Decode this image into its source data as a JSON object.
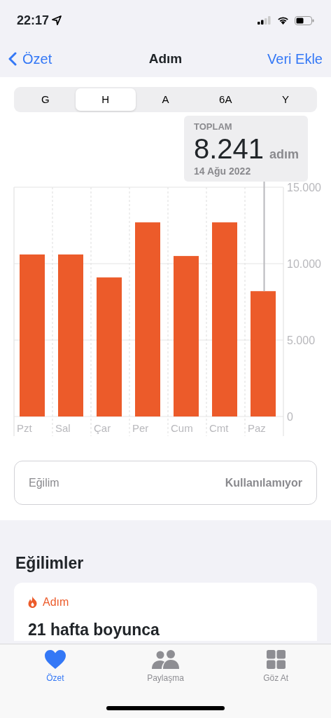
{
  "status_bar": {
    "time": "22:17"
  },
  "nav": {
    "back": "Özet",
    "title": "Adım",
    "action": "Veri Ekle"
  },
  "segments": [
    {
      "label": "G",
      "selected": false
    },
    {
      "label": "H",
      "selected": true
    },
    {
      "label": "A",
      "selected": false
    },
    {
      "label": "6A",
      "selected": false
    },
    {
      "label": "Y",
      "selected": false
    }
  ],
  "summary": {
    "label": "TOPLAM",
    "value": "8.241",
    "unit": "adım",
    "date": "14 Ağu 2022"
  },
  "chart": {
    "chart_data": {
      "type": "bar",
      "categories": [
        "Pzt",
        "Sal",
        "Çar",
        "Per",
        "Cum",
        "Cmt",
        "Paz"
      ],
      "series": [
        {
          "color": "#ec5b2a",
          "values": [
            10600,
            10600,
            9100,
            12700,
            10500,
            12700,
            8200
          ]
        }
      ],
      "ylim": [
        0,
        15000
      ],
      "yticks": [
        {
          "value": 0,
          "label": "0"
        },
        {
          "value": 5000,
          "label": "5.000"
        },
        {
          "value": 10000,
          "label": "10.000"
        },
        {
          "value": 15000,
          "label": "15.000"
        }
      ]
    }
  },
  "trend_row": {
    "label": "Eğilim",
    "value": "Kullanılamıyor"
  },
  "trends": {
    "heading": "Eğilimler",
    "card": {
      "category": "Adım",
      "headline": "21 hafta boyunca"
    }
  },
  "tab_bar": [
    {
      "label": "Özet",
      "selected": true
    },
    {
      "label": "Paylaşma",
      "selected": false
    },
    {
      "label": "Göz At",
      "selected": false
    }
  ]
}
